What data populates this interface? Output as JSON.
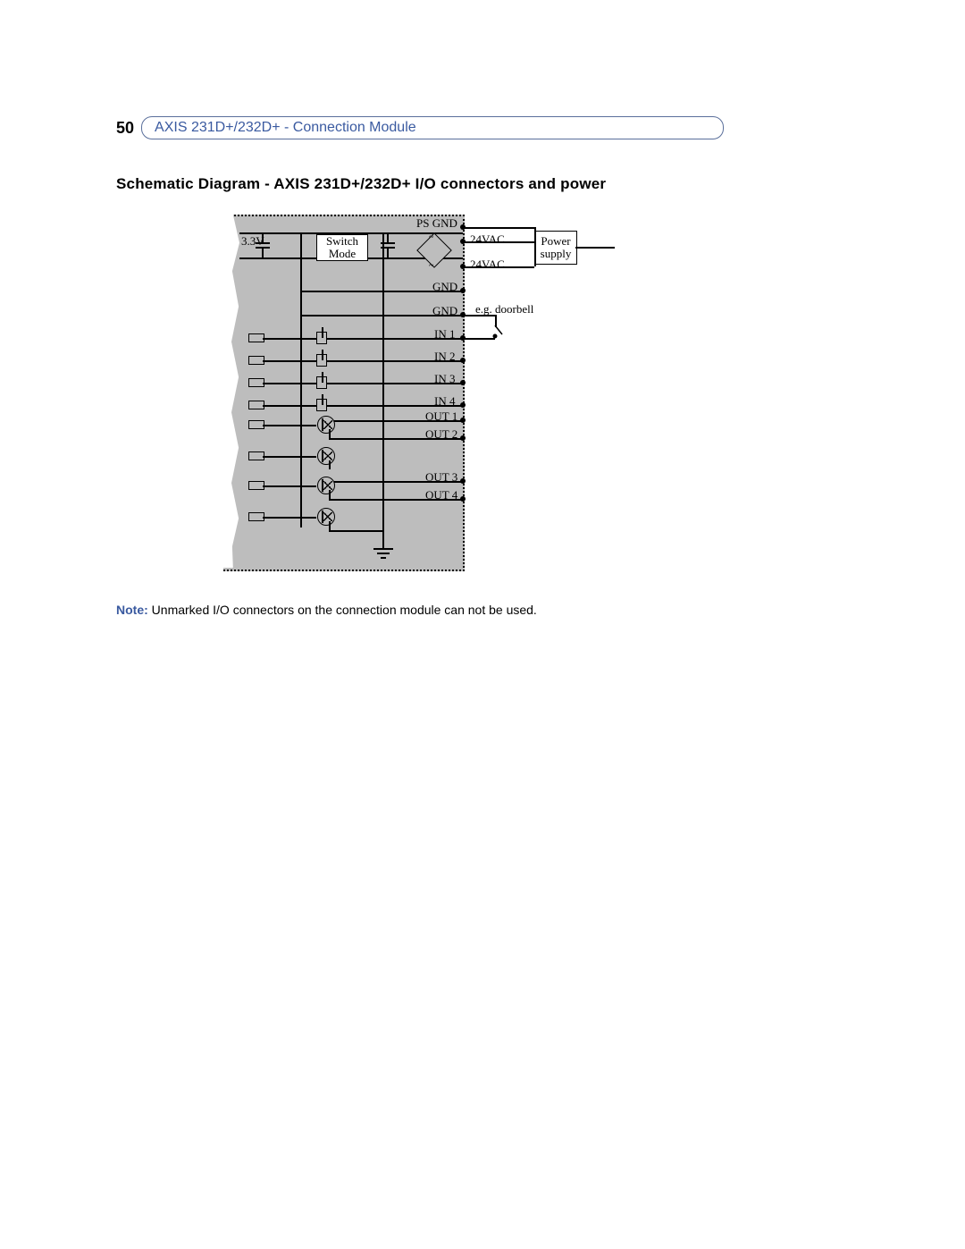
{
  "page_number": "50",
  "header": "AXIS 231D+/232D+ - Connection Module",
  "section_title": "Schematic Diagram - AXIS 231D+/232D+ I/O connectors and power",
  "note_label": "Note:",
  "note_text": "Unmarked I/O connectors on the connection module can not be used.",
  "schematic": {
    "rail_voltage": "3.3V",
    "switch_mode": "Switch\nMode",
    "power_supply": "Power\nsupply",
    "example_device": "e.g. doorbell",
    "pins": {
      "ps_gnd": "PS GND",
      "vac1": "24VAC",
      "vac2": "24VAC",
      "gnd1": "GND",
      "gnd2": "GND",
      "in1": "IN 1",
      "in2": "IN 2",
      "in3": "IN 3",
      "in4": "IN 4",
      "out1": "OUT 1",
      "out2": "OUT 2",
      "out3": "OUT 3",
      "out4": "OUT 4"
    }
  }
}
